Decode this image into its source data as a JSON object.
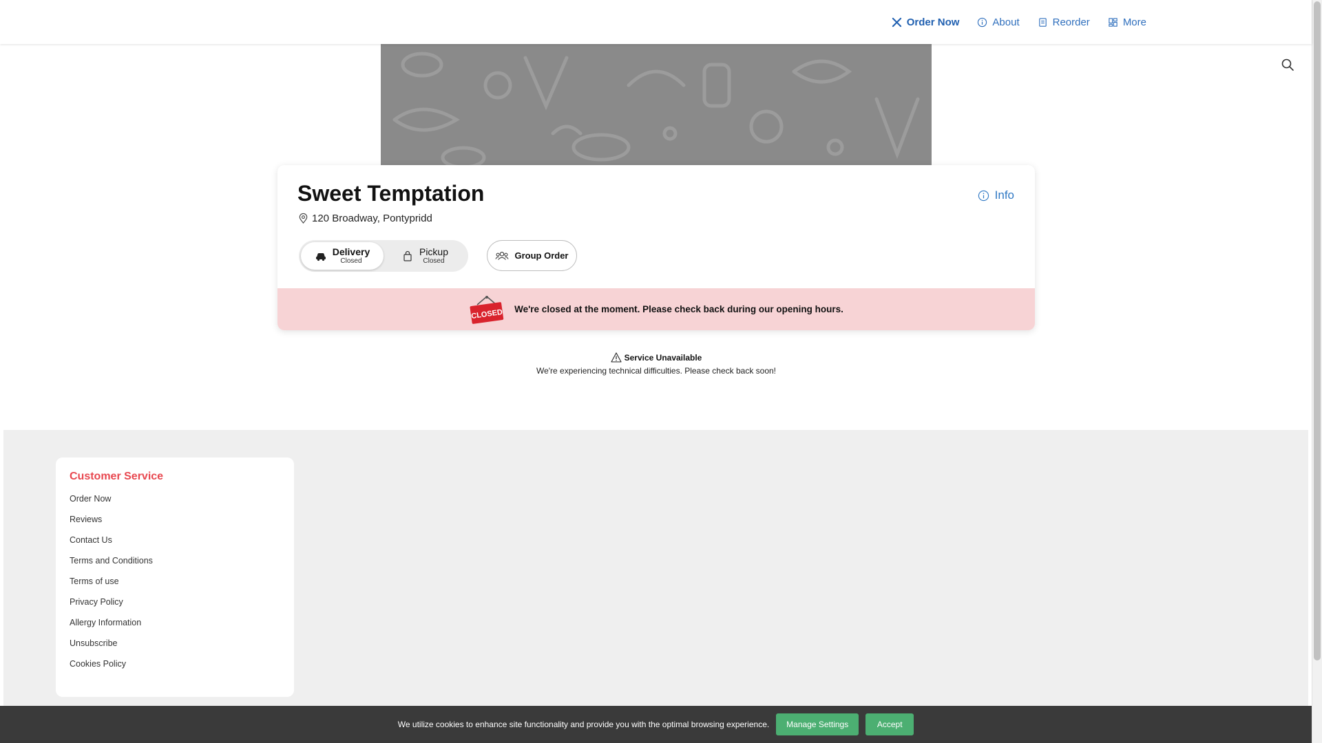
{
  "nav": {
    "items": [
      {
        "label": "Order Now",
        "icon": "utensils-icon",
        "active": true
      },
      {
        "label": "About",
        "icon": "info-circle-icon",
        "active": false
      },
      {
        "label": "Reorder",
        "icon": "receipt-icon",
        "active": false
      },
      {
        "label": "More",
        "icon": "grid-icon",
        "active": false
      }
    ],
    "search_icon": "search-icon"
  },
  "restaurant": {
    "name": "Sweet Temptation",
    "address": "120 Broadway, Pontypridd",
    "info_label": "Info"
  },
  "fulfillment": {
    "delivery_label": "Delivery",
    "delivery_status": "Closed",
    "pickup_label": "Pickup",
    "pickup_status": "Closed",
    "selected": "Delivery"
  },
  "group_order_label": "Group Order",
  "closed_notice": {
    "sign_text": "CLOSED",
    "message": "We're closed at the moment. Please check back during our opening hours."
  },
  "service": {
    "title": "Service Unavailable",
    "message": "We're experiencing technical difficulties. Please check back soon!"
  },
  "footer": {
    "title": "Customer Service",
    "links": [
      "Order Now",
      "Reviews",
      "Contact Us",
      "Terms and Conditions",
      "Terms of use",
      "Privacy Policy",
      "Allergy Information",
      "Unsubscribe",
      "Cookies Policy"
    ]
  },
  "cookie_bar": {
    "text": "We utilize cookies to enhance site functionality and provide you with the optimal browsing experience.",
    "manage_label": "Manage Settings",
    "accept_label": "Accept"
  },
  "colors": {
    "accent_blue": "#2f6fbd",
    "footer_title": "#e8474f",
    "closed_banner": "#f7d3d5",
    "cookie_button": "#4caf72"
  }
}
